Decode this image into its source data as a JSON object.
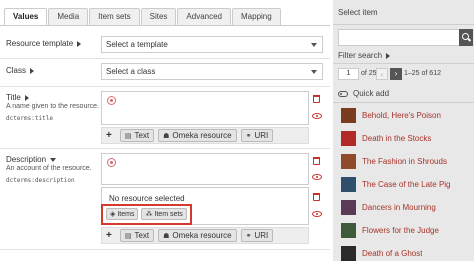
{
  "tabs": [
    "Values",
    "Media",
    "Item sets",
    "Sites",
    "Advanced",
    "Mapping"
  ],
  "resource_template": {
    "label": "Resource template",
    "value": "Select a template"
  },
  "class_field": {
    "label": "Class",
    "value": "Select a class"
  },
  "title_field": {
    "label": "Title",
    "description": "A name given to the resource.",
    "term": "dcterms:title"
  },
  "description_field": {
    "label": "Description",
    "description": "An account of the resource.",
    "term": "dcterms:description"
  },
  "add_buttons": {
    "text": "Text",
    "omeka_resource": "Omeka resource",
    "uri": "URI"
  },
  "resource_value": {
    "message": "No resource selected",
    "items_button": "Items",
    "item_sets_button": "Item sets"
  },
  "sidebar": {
    "title": "Select item",
    "filter_label": "Filter search",
    "page": "1",
    "of_pages": "of 25",
    "range": "1–25 of 612",
    "quick_add": "Quick add",
    "items": [
      "Behold, Here's Poison",
      "Death in the Stocks",
      "The Fashion in Shrouds",
      "The Case of the Late Pig",
      "Dancers in Mourning",
      "Flowers for the Judge",
      "Death of a Ghost"
    ]
  },
  "colors": {
    "accent_red": "#d63a2e",
    "link_red": "#a83228",
    "sidebar_bg": "#e8e8e8"
  }
}
